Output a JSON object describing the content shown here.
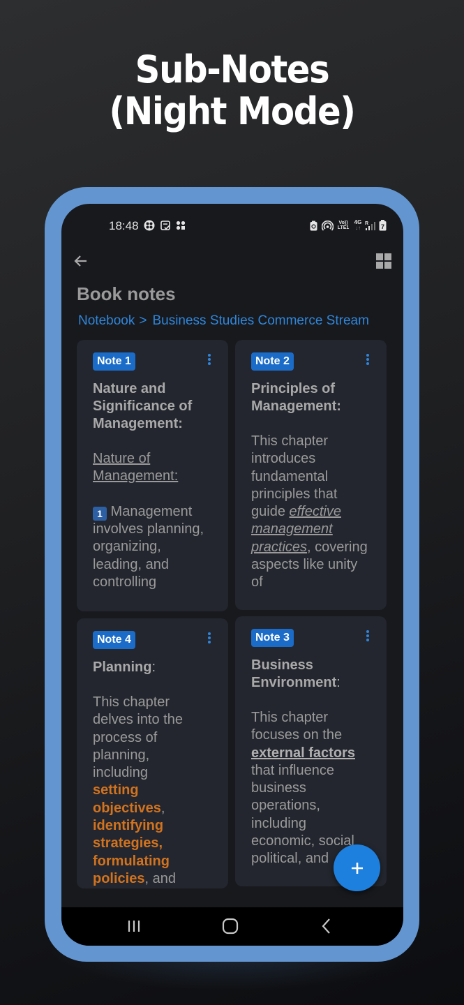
{
  "headline": {
    "line1": "Sub-Notes",
    "line2": "(Night Mode)"
  },
  "status_bar": {
    "time": "18:48",
    "left_icons": [
      "game-icon",
      "note-check-icon",
      "apps-icon"
    ],
    "right_icons": [
      "battery-saver-icon",
      "hotspot-icon",
      "volte-icon",
      "4g-icon",
      "signal-icon",
      "battery-icon"
    ],
    "volte_label_top": "Vo))",
    "volte_label_bottom": "LTE1",
    "network_label": "4G",
    "network_arrows": "↓↑",
    "roaming_label": "R",
    "battery_level_label": "7"
  },
  "app_bar": {
    "back_icon": "arrow-left-icon",
    "view_toggle_icon": "grid-view-icon",
    "title": "Book notes"
  },
  "breadcrumb": {
    "root": "Notebook",
    "separator": ">",
    "current": "Business Studies Commerce Stream"
  },
  "colors": {
    "accent": "#2f86db",
    "badge": "#1b6cc8",
    "highlight_orange": "#d1731f",
    "card_bg": "#23262e",
    "screen_bg": "#18191d",
    "frame": "#6396d1",
    "fab": "#1e80de"
  },
  "notes": [
    {
      "badge": "Note 1",
      "title": "Nature and Significance of Management",
      "title_suffix": ":",
      "body": {
        "underlined_heading": "Nature of Management:",
        "keycap": "1",
        "text": " Management involves planning, organizing, leading, and controlling"
      }
    },
    {
      "badge": "Note 2",
      "title": "Principles of Management",
      "title_suffix": ":",
      "body": {
        "text_before": "This chapter introduces fundamental principles that guide ",
        "emphasis": "effective management practices",
        "text_after": ", covering aspects like unity of"
      }
    },
    {
      "badge": "Note 4",
      "title": "Planning",
      "title_suffix": ":",
      "body": {
        "text_before": "This chapter delves into the process of planning, including ",
        "highlight1": "setting objectives",
        "sep1": ", ",
        "highlight2": "identifying strategies, formulating policies",
        "text_after": ", and"
      }
    },
    {
      "badge": "Note 3",
      "title": "Business Environment",
      "title_suffix": ":",
      "body": {
        "text_before": "This chapter focuses on the ",
        "emphasis": "external factors",
        "text_after": " that influence business operations, including economic, social political, and"
      }
    }
  ],
  "fab": {
    "icon": "plus-icon",
    "label": "+"
  },
  "nav_bar": {
    "recents_icon": "recents-icon",
    "home_icon": "home-icon",
    "back_icon": "back-chevron-icon"
  }
}
